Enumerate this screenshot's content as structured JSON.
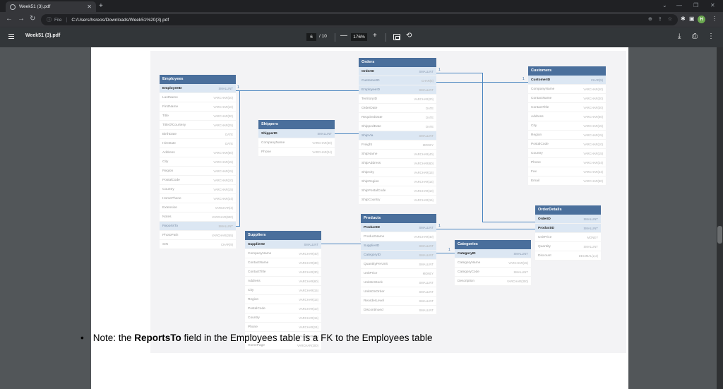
{
  "browser": {
    "tab_title": "Week51 (3).pdf",
    "url_scheme": "File",
    "url_path": "C:/Users/hsreos/Downloads/Week51%20(3).pdf",
    "avatar_letter": "H"
  },
  "pdf_viewer": {
    "file_title": "Week51 (3).pdf",
    "current_page": "6",
    "total_pages": "/ 10",
    "zoom": "176%"
  },
  "diagram": {
    "tables": {
      "employees": {
        "name": "Employees",
        "rows": [
          {
            "col": "EmployeeID",
            "type": "SMALLINT",
            "key": "pk"
          },
          {
            "col": "LastName",
            "type": "VARCHAR(20)"
          },
          {
            "col": "FirstName",
            "type": "VARCHAR(10)"
          },
          {
            "col": "Title",
            "type": "VARCHAR(30)"
          },
          {
            "col": "TitleOfCourtesy",
            "type": "VARCHAR(25)"
          },
          {
            "col": "BirthDate",
            "type": "DATE"
          },
          {
            "col": "HireDate",
            "type": "DATE"
          },
          {
            "col": "Address",
            "type": "VARCHAR(60)"
          },
          {
            "col": "City",
            "type": "VARCHAR(15)"
          },
          {
            "col": "Region",
            "type": "VARCHAR(15)"
          },
          {
            "col": "PostalCode",
            "type": "VARCHAR(10)"
          },
          {
            "col": "Country",
            "type": "VARCHAR(15)"
          },
          {
            "col": "HomePhone",
            "type": "VARCHAR(24)"
          },
          {
            "col": "Extension",
            "type": "VARCHAR(4)"
          },
          {
            "col": "Notes",
            "type": "VARCHAR(600)"
          },
          {
            "col": "ReportsTo",
            "type": "SMALLINT",
            "key": "fk"
          },
          {
            "col": "PhotoPath",
            "type": "VARCHAR(255)"
          },
          {
            "col": "SIN",
            "type": "CHAR(9)"
          }
        ]
      },
      "shippers": {
        "name": "Shippers",
        "rows": [
          {
            "col": "ShipperID",
            "type": "SMALLINT",
            "key": "pk"
          },
          {
            "col": "CompanyName",
            "type": "VARCHAR(40)"
          },
          {
            "col": "Phone",
            "type": "VARCHAR(24)"
          }
        ]
      },
      "orders": {
        "name": "Orders",
        "rows": [
          {
            "col": "OrderID",
            "type": "SMALLINT",
            "key": "pk"
          },
          {
            "col": "CustomerID",
            "type": "CHAR(5)",
            "key": "fk"
          },
          {
            "col": "EmployeeID",
            "type": "SMALLINT",
            "key": "fk"
          },
          {
            "col": "TerritoryID",
            "type": "VARCHAR(20)"
          },
          {
            "col": "OrderDate",
            "type": "DATE"
          },
          {
            "col": "RequiredDate",
            "type": "DATE"
          },
          {
            "col": "ShippedDate",
            "type": "DATE"
          },
          {
            "col": "ShipVia",
            "type": "SMALLINT",
            "key": "fk"
          },
          {
            "col": "Freight",
            "type": "MONEY"
          },
          {
            "col": "ShipName",
            "type": "VARCHAR(40)"
          },
          {
            "col": "ShipAddress",
            "type": "VARCHAR(60)"
          },
          {
            "col": "ShipCity",
            "type": "VARCHAR(15)"
          },
          {
            "col": "ShipRegion",
            "type": "VARCHAR(15)"
          },
          {
            "col": "ShipPostalCode",
            "type": "VARCHAR(10)"
          },
          {
            "col": "ShipCountry",
            "type": "VARCHAR(15)"
          }
        ]
      },
      "customers": {
        "name": "Customers",
        "rows": [
          {
            "col": "CustomerID",
            "type": "CHAR(5)",
            "key": "pk"
          },
          {
            "col": "CompanyName",
            "type": "VARCHAR(40)"
          },
          {
            "col": "ContactName",
            "type": "VARCHAR(30)"
          },
          {
            "col": "ContactTitle",
            "type": "VARCHAR(30)"
          },
          {
            "col": "Address",
            "type": "VARCHAR(60)"
          },
          {
            "col": "City",
            "type": "VARCHAR(15)"
          },
          {
            "col": "Region",
            "type": "VARCHAR(15)"
          },
          {
            "col": "PostalCode",
            "type": "VARCHAR(10)"
          },
          {
            "col": "Country",
            "type": "VARCHAR(15)"
          },
          {
            "col": "Phone",
            "type": "VARCHAR(24)"
          },
          {
            "col": "Fax",
            "type": "VARCHAR(24)"
          },
          {
            "col": "Email",
            "type": "VARCHAR(50)"
          }
        ]
      },
      "products": {
        "name": "Products",
        "rows": [
          {
            "col": "ProductID",
            "type": "SMALLINT",
            "key": "pk"
          },
          {
            "col": "ProductName",
            "type": "VARCHAR(40)"
          },
          {
            "col": "SupplierID",
            "type": "SMALLINT",
            "key": "fk"
          },
          {
            "col": "CategoryID",
            "type": "SMALLINT",
            "key": "fk"
          },
          {
            "col": "QuantityPerUnit",
            "type": "SMALLINT"
          },
          {
            "col": "UnitPrice",
            "type": "MONEY"
          },
          {
            "col": "UnitsInStock",
            "type": "SMALLINT"
          },
          {
            "col": "UnitsOnOrder",
            "type": "SMALLINT"
          },
          {
            "col": "ReorderLevel",
            "type": "SMALLINT"
          },
          {
            "col": "Discontinued",
            "type": "SMALLINT"
          }
        ]
      },
      "suppliers": {
        "name": "Suppliers",
        "rows": [
          {
            "col": "SupplierID",
            "type": "SMALLINT",
            "key": "pk"
          },
          {
            "col": "CompanyName",
            "type": "VARCHAR(40)"
          },
          {
            "col": "ContactName",
            "type": "VARCHAR(30)"
          },
          {
            "col": "ContactTitle",
            "type": "VARCHAR(30)"
          },
          {
            "col": "Address",
            "type": "VARCHAR(60)"
          },
          {
            "col": "City",
            "type": "VARCHAR(15)"
          },
          {
            "col": "Region",
            "type": "VARCHAR(15)"
          },
          {
            "col": "PostalCode",
            "type": "VARCHAR(10)"
          },
          {
            "col": "Country",
            "type": "VARCHAR(15)"
          },
          {
            "col": "Phone",
            "type": "VARCHAR(24)"
          },
          {
            "col": "Fax",
            "type": "VARCHAR(24)"
          },
          {
            "col": "HomePage",
            "type": "VARCHAR(200)"
          }
        ]
      },
      "categories": {
        "name": "Categories",
        "rows": [
          {
            "col": "CategoryID",
            "type": "SMALLINT",
            "key": "pk"
          },
          {
            "col": "CategoryName",
            "type": "VARCHAR(15)"
          },
          {
            "col": "CategoryCode",
            "type": "SMALLINT"
          },
          {
            "col": "Description",
            "type": "VARCHAR(300)"
          }
        ]
      },
      "orderdetails": {
        "name": "OrderDetails",
        "rows": [
          {
            "col": "OrderID",
            "type": "SMALLINT",
            "key": "pk"
          },
          {
            "col": "ProductID",
            "type": "SMALLINT",
            "key": "pk"
          },
          {
            "col": "UnitPrice",
            "type": "MONEY"
          },
          {
            "col": "Quantity",
            "type": "SMALLINT"
          },
          {
            "col": "Discount",
            "type": "DECIMAL(2,2)"
          }
        ]
      }
    },
    "one_marker": "1"
  },
  "note": {
    "bullet": "•",
    "before": "Note: the ",
    "field": "ReportsTo",
    "after": " field in the Employees table is a FK to the Employees table"
  }
}
